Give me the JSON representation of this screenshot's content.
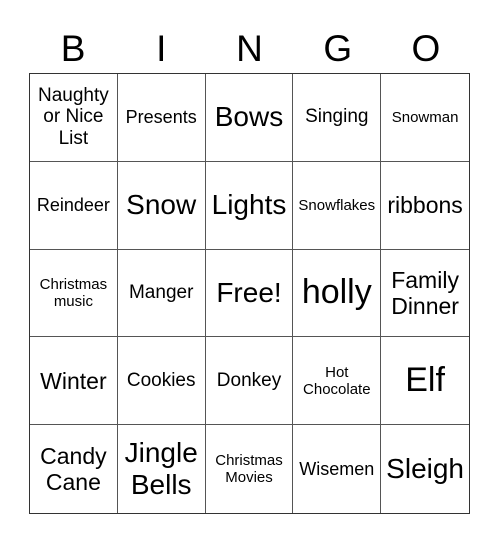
{
  "header": {
    "letters": [
      "B",
      "I",
      "N",
      "G",
      "O"
    ]
  },
  "cells": [
    {
      "text": "Naughty or Nice List",
      "size": "s3"
    },
    {
      "text": "Presents",
      "size": "s2"
    },
    {
      "text": "Bows",
      "size": "s5"
    },
    {
      "text": "Singing",
      "size": "s3"
    },
    {
      "text": "Snowman",
      "size": "s1"
    },
    {
      "text": "Reindeer",
      "size": "s2"
    },
    {
      "text": "Snow",
      "size": "s5"
    },
    {
      "text": "Lights",
      "size": "s5"
    },
    {
      "text": "Snowflakes",
      "size": "s1"
    },
    {
      "text": "ribbons",
      "size": "s4"
    },
    {
      "text": "Christmas music",
      "size": "s1"
    },
    {
      "text": "Manger",
      "size": "s3"
    },
    {
      "text": "Free!",
      "size": "s5"
    },
    {
      "text": "holly",
      "size": "s6"
    },
    {
      "text": "Family Dinner",
      "size": "s4"
    },
    {
      "text": "Winter",
      "size": "s4"
    },
    {
      "text": "Cookies",
      "size": "s3"
    },
    {
      "text": "Donkey",
      "size": "s3"
    },
    {
      "text": "Hot Chocolate",
      "size": "s1"
    },
    {
      "text": "Elf",
      "size": "s6"
    },
    {
      "text": "Candy Cane",
      "size": "s4"
    },
    {
      "text": "Jingle Bells",
      "size": "s5"
    },
    {
      "text": "Christmas Movies",
      "size": "s1"
    },
    {
      "text": "Wisemen",
      "size": "s2"
    },
    {
      "text": "Sleigh",
      "size": "s5"
    }
  ]
}
